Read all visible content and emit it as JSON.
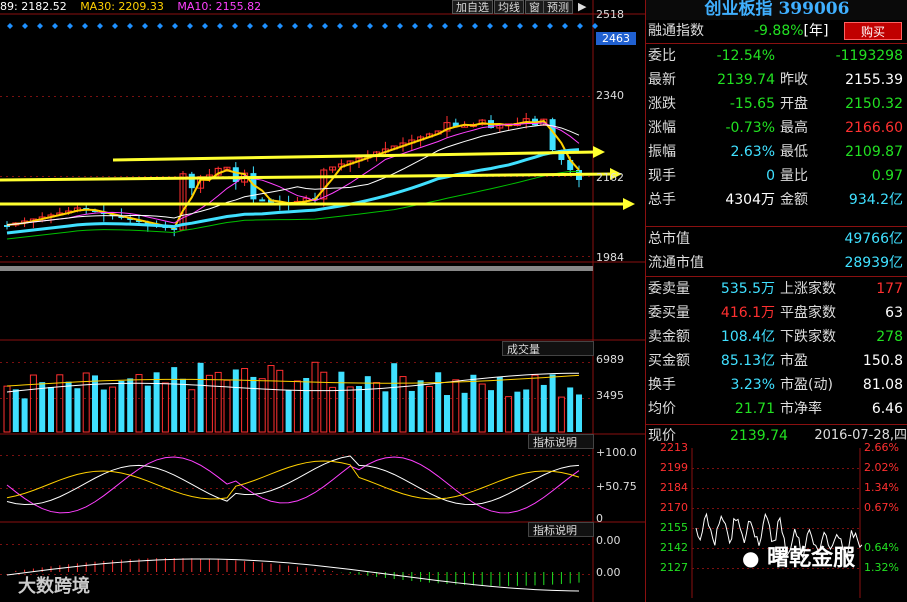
{
  "ma_legend": [
    {
      "text": "89: 2182.52",
      "color": "#ffffff"
    },
    {
      "text": "MA30: 2209.33",
      "color": "#ffd000"
    },
    {
      "text": "MA10: 2155.82",
      "color": "#ff40ff"
    }
  ],
  "toolbar": {
    "add_select": "加自选",
    "ma_line": "均线",
    "window": "窗",
    "forecast": "预测",
    "arrow": "▶"
  },
  "price_axis": {
    "p1": "2518",
    "p2": "2463",
    "p3": "2340",
    "p4": "2162",
    "p5": "1984"
  },
  "volume": {
    "header": "成交量",
    "v1": "6989",
    "v2": "3495"
  },
  "indicator1": {
    "header": "指标说明",
    "top": "+100.0",
    "mid": "+50.75",
    "bottom": "0"
  },
  "indicator2": {
    "header": "指标说明",
    "top": "0.00",
    "bottom": "0.00"
  },
  "quote": {
    "title": "创业板指 399006",
    "margin_label": "融通指数",
    "margin_value": "-9.88%",
    "margin_unit": "[年]",
    "buy_button": "购买",
    "rows_top": [
      {
        "l1": "委比",
        "v1": "-12.54%",
        "c1": "g",
        "l2": "",
        "v2": "-1193298",
        "c2": "g"
      },
      {
        "l1": "最新",
        "v1": "2139.74",
        "c1": "g",
        "l2": "昨收",
        "v2": "2155.39",
        "c2": "w"
      },
      {
        "l1": "涨跌",
        "v1": "-15.65",
        "c1": "g",
        "l2": "开盘",
        "v2": "2150.32",
        "c2": "g"
      },
      {
        "l1": "涨幅",
        "v1": "-0.73%",
        "c1": "g",
        "l2": "最高",
        "v2": "2166.60",
        "c2": "r"
      },
      {
        "l1": "振幅",
        "v1": "2.63%",
        "c1": "c",
        "l2": "最低",
        "v2": "2109.87",
        "c2": "g"
      },
      {
        "l1": "现手",
        "v1": "0",
        "c1": "c",
        "l2": "量比",
        "v2": "0.97",
        "c2": "g"
      },
      {
        "l1": "总手",
        "v1": "4304万",
        "c1": "w",
        "l2": "金额",
        "v2": "934.2亿",
        "c2": "c"
      }
    ],
    "total_mv_label": "总市值",
    "total_mv": "49766亿",
    "float_mv_label": "流通市值",
    "float_mv": "28939亿",
    "rows_mid": [
      {
        "l1": "委卖量",
        "v1": "535.5万",
        "c1": "c",
        "l2": "上涨家数",
        "v2": "177",
        "c2": "r"
      },
      {
        "l1": "委买量",
        "v1": "416.1万",
        "c1": "r",
        "l2": "平盘家数",
        "v2": "63",
        "c2": "w"
      },
      {
        "l1": "卖金额",
        "v1": "108.4亿",
        "c1": "c",
        "l2": "下跌家数",
        "v2": "278",
        "c2": "g"
      },
      {
        "l1": "买金额",
        "v1": "85.13亿",
        "c1": "c",
        "l2": "市盈",
        "v2": "150.8",
        "c2": "w"
      },
      {
        "l1": "换手",
        "v1": "3.23%",
        "c1": "c",
        "l2": "市盈(动)",
        "v2": "81.08",
        "c2": "w"
      },
      {
        "l1": "均价",
        "v1": "21.71",
        "c1": "g",
        "l2": "市净率",
        "v2": "6.46",
        "c2": "w"
      }
    ],
    "now_label": "现价",
    "now_price": "2139.74",
    "now_date": "2016-07-28,四",
    "mini_left": [
      "2213",
      "2199",
      "2184",
      "2170",
      "2155",
      "2142",
      "2127"
    ],
    "mini_right": [
      "2.66%",
      "2.02%",
      "1.34%",
      "0.67%",
      "",
      "0.64%",
      "1.32%"
    ]
  },
  "watermarks": {
    "left": "大数跨境",
    "right": "曙乾金服"
  },
  "colors": {
    "up": "#ff3030",
    "down": "#40e0ff",
    "ma_yellow": "#ffd000",
    "trend_arrow": "#ffff30"
  }
}
